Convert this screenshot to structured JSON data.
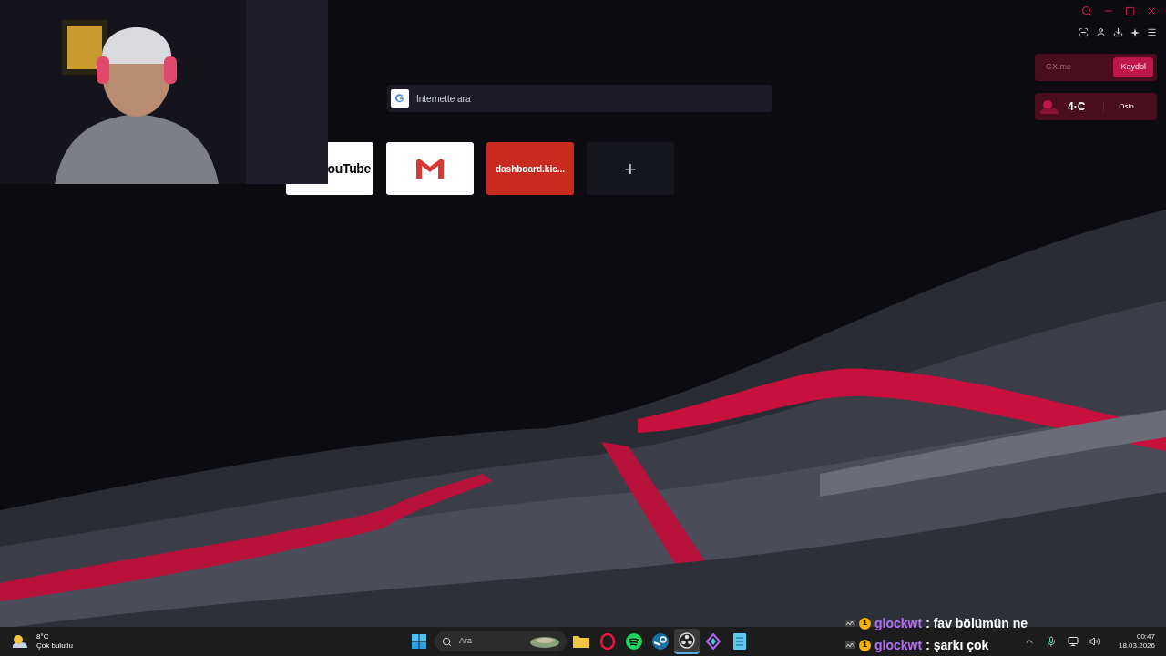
{
  "search": {
    "placeholder": "İnternette ara"
  },
  "speed_dials": [
    {
      "kind": "youtube",
      "label": "ouTube"
    },
    {
      "kind": "gmail"
    },
    {
      "kind": "site",
      "label": "dashboard.kic..."
    },
    {
      "kind": "add",
      "label": "+"
    }
  ],
  "gx_widget": {
    "tabs": [
      {
        "label": "GX.me",
        "selected": false
      },
      {
        "label": "Kaydol",
        "selected": true
      }
    ]
  },
  "weather_widget": {
    "temperature": "4·C",
    "city": "Oslo"
  },
  "taskbar": {
    "weather": {
      "temperature": "8°C",
      "condition": "Çok bulutlu"
    },
    "search": {
      "placeholder": "Ara"
    },
    "apps": [
      {
        "kind": "folder",
        "selected": false
      },
      {
        "kind": "opera",
        "selected": false
      },
      {
        "kind": "spotify",
        "selected": false
      },
      {
        "kind": "steam",
        "selected": false
      },
      {
        "kind": "obs",
        "selected": true
      },
      {
        "kind": "diamond",
        "selected": false
      },
      {
        "kind": "notepad",
        "selected": false
      }
    ],
    "clock": {
      "time": "00:47",
      "date": "18.03.2026"
    }
  },
  "chat": [
    {
      "user": "glockwt",
      "badge": "1",
      "message": ": fav bölümün ne"
    },
    {
      "user": "glockwt",
      "badge": "1",
      "message": ": şarkı çok"
    }
  ]
}
